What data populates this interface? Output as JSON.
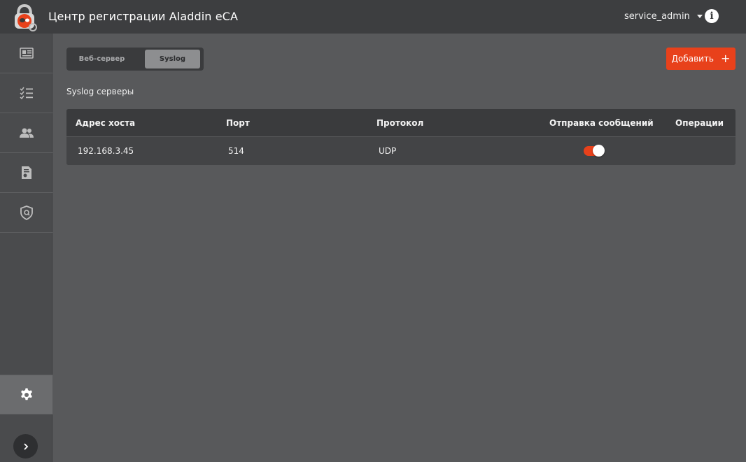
{
  "header": {
    "app_title": "Центр регистрации Aladdin eCA",
    "username": "service_admin"
  },
  "sidebar": {
    "items": [
      {
        "icon": "id-card-icon"
      },
      {
        "icon": "checklist-icon"
      },
      {
        "icon": "users-icon"
      },
      {
        "icon": "certificate-icon"
      },
      {
        "icon": "shield-icon"
      }
    ],
    "settings_icon": "gear-icon",
    "expand_icon": "chevron-right-icon"
  },
  "tabs": [
    {
      "label": "Веб-сервер",
      "active": false
    },
    {
      "label": "Syslog",
      "active": true
    }
  ],
  "add_button": {
    "label": "Добавить",
    "icon": "plus-icon"
  },
  "section_title": "Syslog серверы",
  "table": {
    "columns": [
      "Адрес хоста",
      "Порт",
      "Протокол",
      "Отправка сообщений",
      "Операции"
    ],
    "rows": [
      {
        "host": "192.168.3.45",
        "port": "514",
        "protocol": "UDP",
        "sending_enabled": true
      }
    ]
  },
  "colors": {
    "accent": "#e8411b",
    "header_bg": "#3d3e40",
    "page_bg": "#58595b",
    "sidebar_bg": "#4a4b4d"
  }
}
